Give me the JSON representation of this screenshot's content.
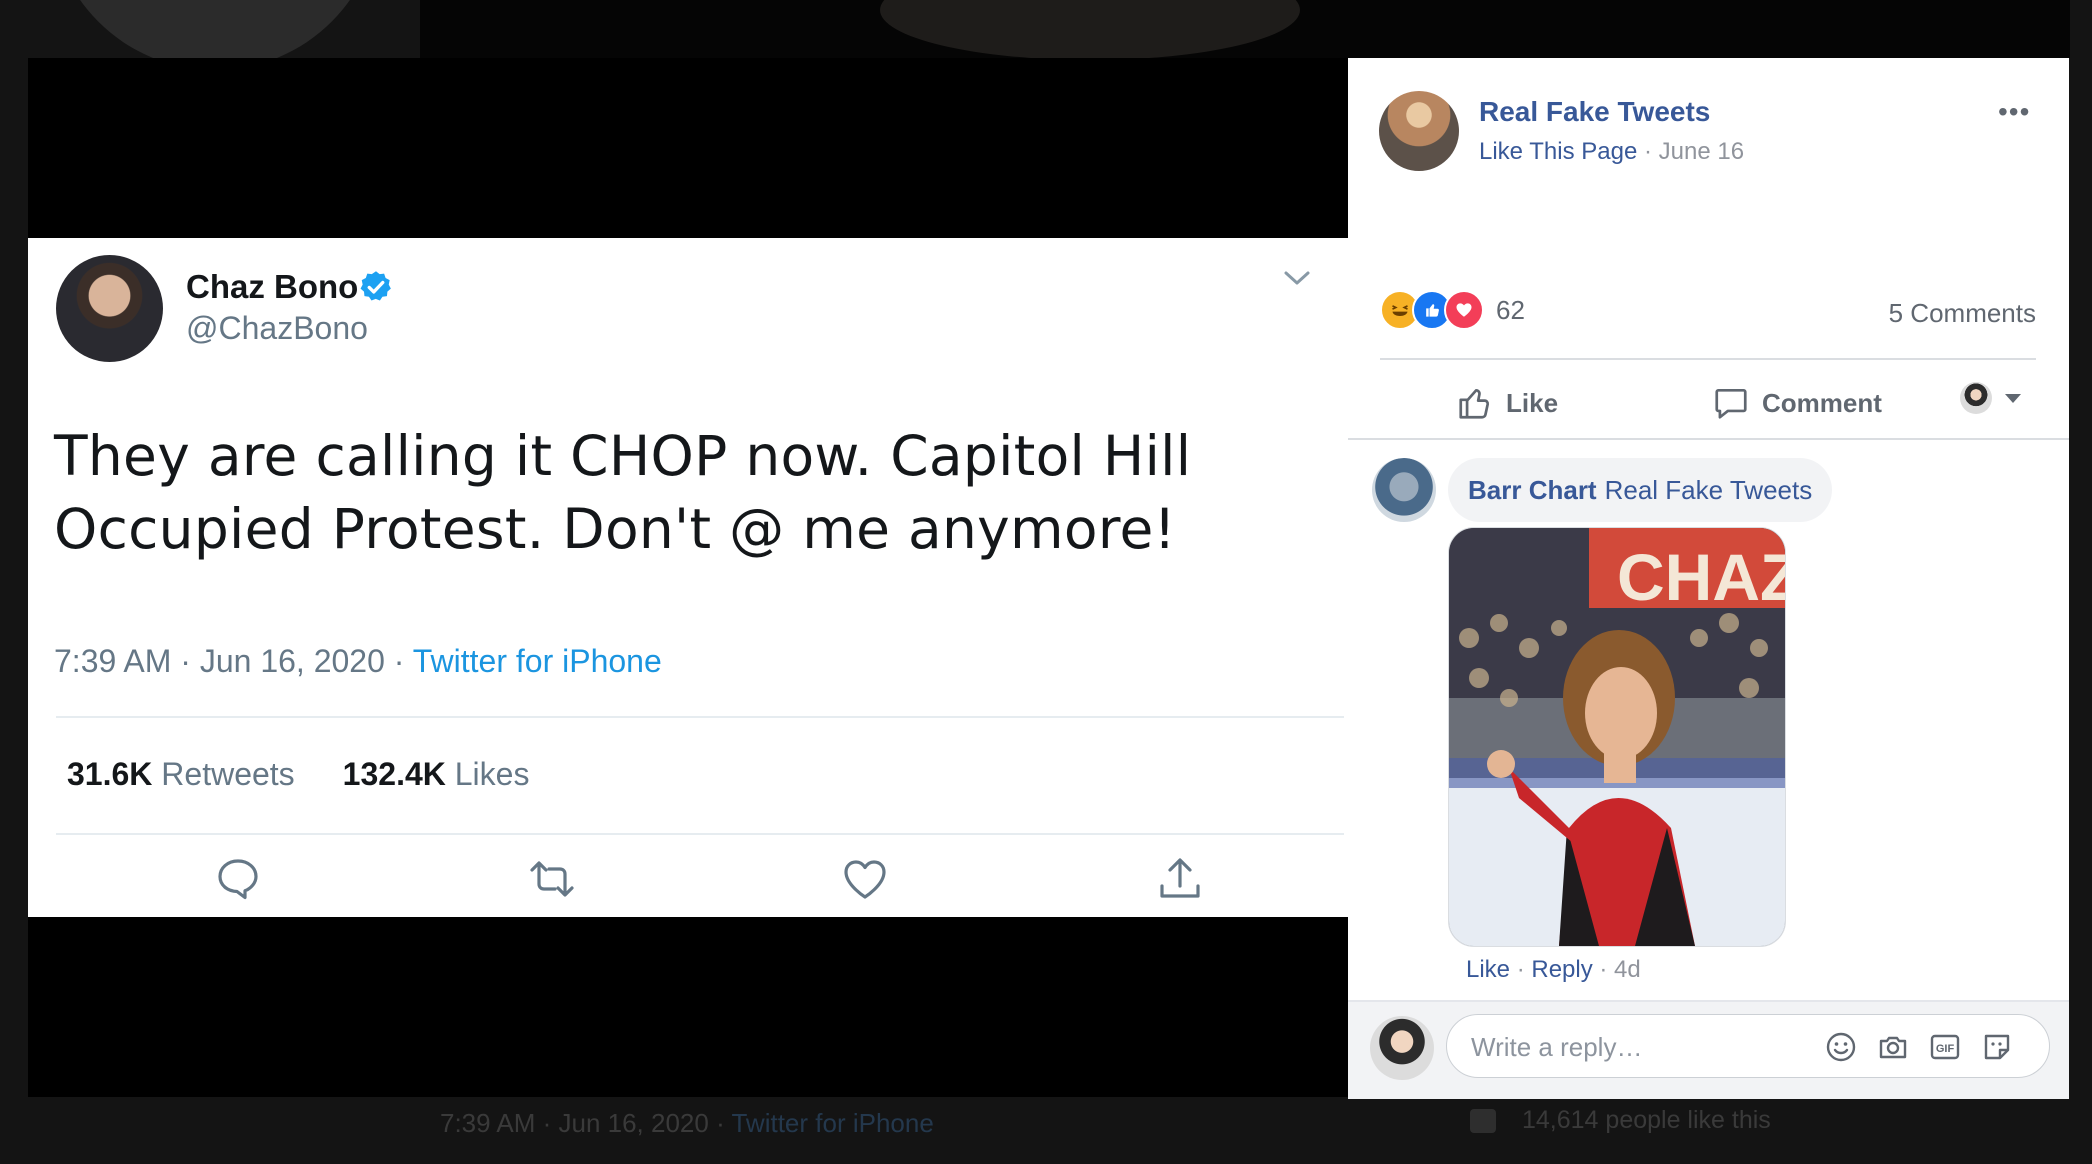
{
  "tweet": {
    "author_name": "Chaz Bono",
    "handle": "@ChazBono",
    "text": "They are calling it CHOP now. Capitol Hill Occupied Protest. Don't @ me anymore!",
    "timestamp": "7:39 AM · Jun 16, 2020 · ",
    "source": "Twitter for iPhone",
    "retweets_count": "31.6K",
    "retweets_label": "Retweets",
    "likes_count": "132.4K",
    "likes_label": "Likes",
    "icons": [
      "reply-icon",
      "retweet-icon",
      "like-heart-icon",
      "share-icon",
      "chevron-down-icon",
      "verified-badge-icon"
    ],
    "colors": {
      "verified": "#1da1f2",
      "link": "#1b95e0"
    }
  },
  "facebook": {
    "page_name": "Real Fake Tweets",
    "like_page_label": "Like This Page",
    "separator": " · ",
    "post_date": "June 16",
    "more_label": "•••",
    "reaction_count": "62",
    "reactions": [
      "haha",
      "like",
      "love"
    ],
    "comments_count": "5 Comments",
    "like_label": "Like",
    "comment_label": "Comment",
    "comment": {
      "author": "Barr Chart",
      "tagged": "Real Fake Tweets",
      "image_overlay_text": "CHAZ",
      "like_label": "Like",
      "reply_label": "Reply",
      "age": "4d"
    },
    "reply_placeholder": "Write a reply…",
    "reply_icons": [
      "emoji-icon",
      "camera-icon",
      "gif-icon",
      "sticker-icon"
    ],
    "colors": {
      "link": "#385898",
      "muted": "#90949c"
    }
  },
  "background": {
    "ghost_timestamp": "7:39 AM · Jun 16, 2020 · ",
    "ghost_source": "Twitter for iPhone",
    "ghost_likes": "14,614 people like this"
  }
}
